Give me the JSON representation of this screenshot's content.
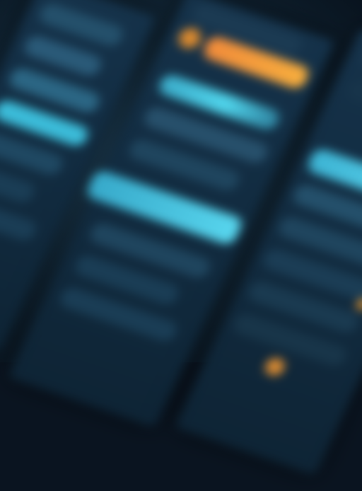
{
  "colors": {
    "background": "#0a1420",
    "panel": "#15324a",
    "panel_dark": "#0e2435",
    "row_muted": "#27506b",
    "row_faint": "#1b3a52",
    "highlight_cyan": "#4fd3ea",
    "highlight_cyan_soft": "#3aa9c7",
    "highlight_orange": "#f39a3a",
    "accent_orange_dot": "#d9892f"
  },
  "left_panel": {
    "rows": [
      "muted",
      "muted",
      "muted",
      "cyan",
      "muted",
      "muted",
      "muted"
    ]
  },
  "middle_panel": {
    "rows": [
      "faint",
      "orange",
      "cyan",
      "muted",
      "muted",
      "cyan-large",
      "muted",
      "muted"
    ]
  },
  "right_panel": {
    "rows": [
      "faint",
      "faint",
      "cyan",
      "muted",
      "muted",
      "muted",
      "muted",
      "muted"
    ]
  }
}
